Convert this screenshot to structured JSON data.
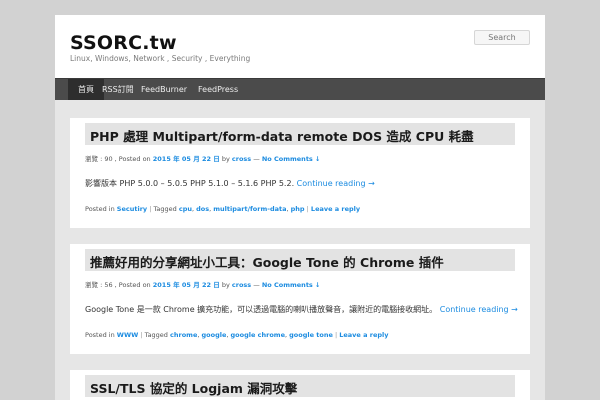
{
  "site": {
    "title": "SSORC.tw",
    "description": "Linux, Windows, Network , Security , Everything"
  },
  "search": {
    "placeholder": "Search"
  },
  "nav": {
    "items": [
      {
        "label": "首頁"
      },
      {
        "label": "RSS訂閱"
      },
      {
        "label": "FeedBurner"
      },
      {
        "label": "FeedPress"
      }
    ]
  },
  "posts": [
    {
      "title": "PHP 處理 Multipart/form-data remote DOS 造成 CPU 耗盡",
      "views_label": "瀏覽 : 90 , Posted on",
      "date": "2015 年 05 月 22 日",
      "by": "by",
      "author": "cross",
      "dash": "—",
      "comments": "No Comments ↓",
      "excerpt": "影響版本 PHP 5.0.0 – 5.0.5 PHP 5.1.0 – 5.1.6 PHP 5.2.",
      "continue": "Continue reading →",
      "posted_in_label": "Posted in",
      "category": "Secutiry",
      "tagged_label": "Tagged",
      "tags": [
        "cpu",
        "dos",
        "multipart/form-data",
        "php"
      ],
      "reply": "Leave a reply"
    },
    {
      "title": "推薦好用的分享網址小工具：Google Tone 的 Chrome 插件",
      "views_label": "瀏覽 : 56 , Posted on",
      "date": "2015 年 05 月 22 日",
      "by": "by",
      "author": "cross",
      "dash": "—",
      "comments": "No Comments ↓",
      "excerpt": "Google Tone 是一款 Chrome 擴充功能，可以透過電腦的喇叭播放聲音，讓附近的電腦接收網址。",
      "continue": "Continue reading →",
      "posted_in_label": "Posted in",
      "category": "WWW",
      "tagged_label": "Tagged",
      "tags": [
        "chrome",
        "google",
        "google chrome",
        "google tone"
      ],
      "reply": "Leave a reply"
    },
    {
      "title": "SSL/TLS 協定的 Logjam 漏洞攻擊"
    }
  ]
}
